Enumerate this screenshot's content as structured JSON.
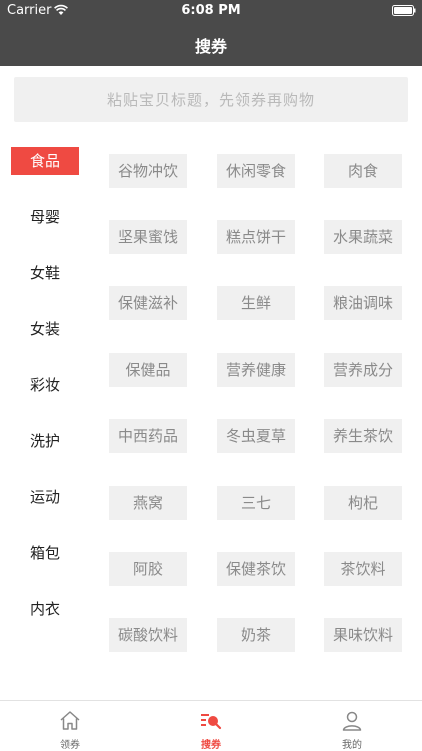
{
  "status": {
    "carrier": "Carrier",
    "time": "6:08 PM"
  },
  "nav": {
    "title": "搜券"
  },
  "search": {
    "placeholder": "粘贴宝贝标题，先领券再购物"
  },
  "categories": [
    "食品",
    "母婴",
    "女鞋",
    "女装",
    "彩妆",
    "洗护",
    "运动",
    "箱包",
    "内衣"
  ],
  "active_category": "食品",
  "tags": [
    [
      "谷物冲饮",
      "休闲零食",
      "肉食"
    ],
    [
      "坚果蜜饯",
      "糕点饼干",
      "水果蔬菜"
    ],
    [
      "保健滋补",
      "生鲜",
      "粮油调味"
    ],
    [
      "保健品",
      "营养健康",
      "营养成分"
    ],
    [
      "中西药品",
      "冬虫夏草",
      "养生茶饮"
    ],
    [
      "燕窝",
      "三七",
      "枸杞"
    ],
    [
      "阿胶",
      "保健茶饮",
      "茶饮料"
    ],
    [
      "碳酸饮料",
      "奶茶",
      "果味饮料"
    ]
  ],
  "tabbar": [
    {
      "label": "领券",
      "icon": "home-icon"
    },
    {
      "label": "搜券",
      "icon": "search-coupon-icon"
    },
    {
      "label": "我的",
      "icon": "user-icon"
    }
  ],
  "colors": {
    "accent": "#ef4a42",
    "topbar": "#4a4a4a",
    "tag_bg": "#f0f0f0"
  }
}
